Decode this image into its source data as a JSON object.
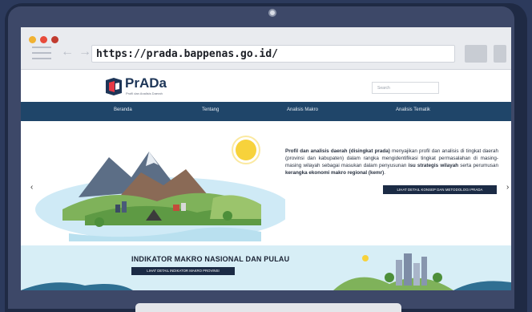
{
  "browser": {
    "url": "https://prada.bappenas.go.id/",
    "dots": [
      "#f1b232",
      "#e84b3b",
      "#c13b2f"
    ]
  },
  "site": {
    "logo_text": "PrADa",
    "logo_subtitle": "Profil dan Analisis Daerah",
    "search_placeholder": "Search"
  },
  "menu": [
    "Beranda",
    "Tentang",
    "Analisis Makro",
    "Analisis Tematik"
  ],
  "hero": {
    "b1": "Profil dan analisis daerah (disingkat prada)",
    "t1": " menyajikan profil dan analisis di tingkat daerah (provinsi dan kabupaten) dalam rangka mengidentifikasi tingkat permasalahan di masing-masing wilayah sebagai masukan dalam penyusunan ",
    "b2": "isu strategis wilayah",
    "t2": " serta perumusan ",
    "b3": "kerangka ekonomi makro regional (kemr)",
    "t3": ".",
    "cta": "LIHAT DETAIL KONSEP DAN METODOLOGI PRADA"
  },
  "indikator": {
    "title": "INDIKATOR MAKRO NASIONAL DAN PULAU",
    "button": "LIHAT DETAIL INDIKATOR MAKRO PROVINSI"
  },
  "colors": {
    "nav": "#1f4569",
    "button": "#1b2b45",
    "sky_band": "#d7eef6",
    "sun": "#f7d23b"
  }
}
